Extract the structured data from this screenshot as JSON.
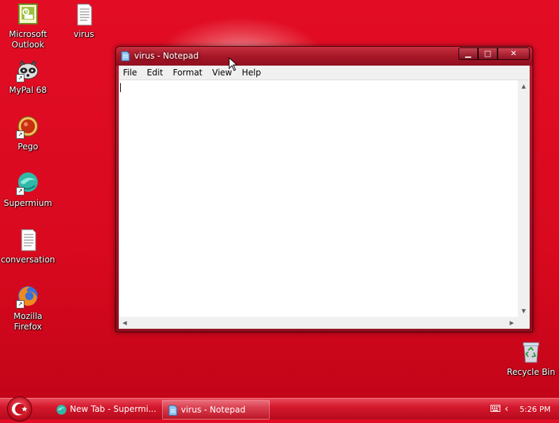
{
  "desktop": {
    "icons": [
      {
        "label": "Microsoft Outlook",
        "icon": "outlook-icon"
      },
      {
        "label": "virus",
        "icon": "text-file-icon"
      },
      {
        "label": "MyPal 68",
        "icon": "mypal-icon"
      },
      {
        "label": "Pego",
        "icon": "pego-icon"
      },
      {
        "label": "Supermium",
        "icon": "supermium-icon"
      },
      {
        "label": "conversation",
        "icon": "text-file-icon"
      },
      {
        "label": "Mozilla Firefox",
        "icon": "firefox-icon"
      },
      {
        "label": "Recycle Bin",
        "icon": "recycle-bin-icon"
      }
    ]
  },
  "window": {
    "title": "virus - Notepad",
    "controls": {
      "minimize": "▁",
      "maximize": "□",
      "close": "✕"
    },
    "menu": [
      "File",
      "Edit",
      "Format",
      "View",
      "Help"
    ],
    "content": ""
  },
  "taskbar": {
    "tasks": [
      {
        "label": "New Tab - Supermi...",
        "icon": "supermium-icon"
      },
      {
        "label": "virus - Notepad",
        "icon": "notepad-icon"
      }
    ],
    "clock": "5:26 PM"
  },
  "colors": {
    "accent": "#d9091f",
    "window_frame": "#a81828"
  }
}
